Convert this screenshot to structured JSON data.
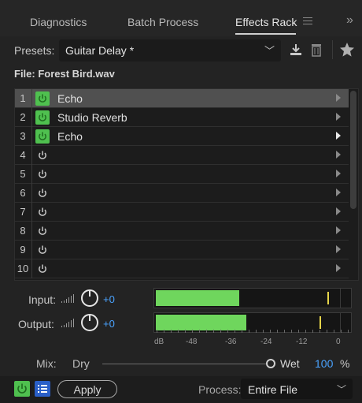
{
  "tabs": [
    {
      "label": "Diagnostics"
    },
    {
      "label": "Batch Process"
    },
    {
      "label": "Effects Rack"
    }
  ],
  "tab_overflow": "»",
  "presets": {
    "label": "Presets:",
    "value": "Guitar Delay *"
  },
  "file": {
    "label": "File: Forest Bird.wav"
  },
  "rack": {
    "slots": [
      {
        "num": "1",
        "name": "Echo",
        "on": true
      },
      {
        "num": "2",
        "name": "Studio Reverb",
        "on": true
      },
      {
        "num": "3",
        "name": "Echo",
        "on": true
      },
      {
        "num": "4",
        "name": "",
        "on": false
      },
      {
        "num": "5",
        "name": "",
        "on": false
      },
      {
        "num": "6",
        "name": "",
        "on": false
      },
      {
        "num": "7",
        "name": "",
        "on": false
      },
      {
        "num": "8",
        "name": "",
        "on": false
      },
      {
        "num": "9",
        "name": "",
        "on": false
      },
      {
        "num": "10",
        "name": "",
        "on": false
      }
    ]
  },
  "input": {
    "label": "Input:",
    "gain": "+0"
  },
  "output": {
    "label": "Output:",
    "gain": "+0"
  },
  "scale": {
    "labels": [
      "dB",
      "-48",
      "-36",
      "-24",
      "-12",
      "0"
    ]
  },
  "mix": {
    "label": "Mix:",
    "dry": "Dry",
    "wet": "Wet",
    "percent": "100",
    "percent_symbol": "%"
  },
  "footer": {
    "apply": "Apply",
    "process_label": "Process:",
    "process_value": "Entire File"
  },
  "colors": {
    "accent_green": "#4fc04f",
    "meter_green": "#6fd65d",
    "accent_blue": "#4aa3ff",
    "peak_yellow": "#e6d54a"
  }
}
